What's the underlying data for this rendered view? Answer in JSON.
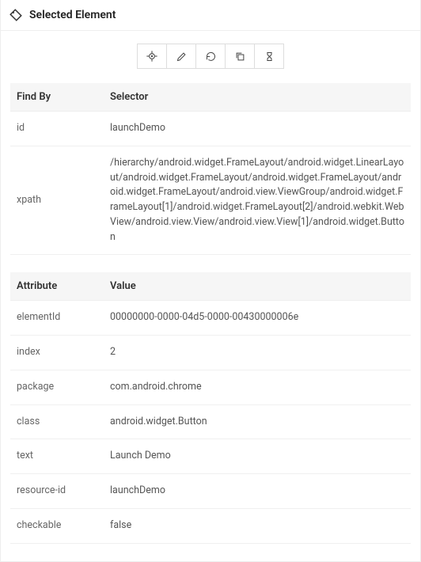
{
  "header": {
    "title": "Selected Element"
  },
  "toolbar": {
    "locate_title": "Locate",
    "edit_title": "Edit",
    "refresh_title": "Refresh",
    "copy_title": "Copy",
    "timing_title": "Timing"
  },
  "findby_table": {
    "headers": {
      "col1": "Find By",
      "col2": "Selector"
    },
    "rows": [
      {
        "k": "id",
        "v": "launchDemo"
      },
      {
        "k": "xpath",
        "v": "/hierarchy/android.widget.FrameLayout/android.widget.LinearLayout/android.widget.FrameLayout/android.widget.FrameLayout/android.widget.FrameLayout/android.view.ViewGroup/android.widget.FrameLayout[1]/android.widget.FrameLayout[2]/android.webkit.WebView/android.view.View/android.view.View[1]/android.widget.Button"
      }
    ]
  },
  "attr_table": {
    "headers": {
      "col1": "Attribute",
      "col2": "Value"
    },
    "rows": [
      {
        "k": "elementId",
        "v": "00000000-0000-04d5-0000-00430000006e"
      },
      {
        "k": "index",
        "v": "2"
      },
      {
        "k": "package",
        "v": "com.android.chrome"
      },
      {
        "k": "class",
        "v": "android.widget.Button"
      },
      {
        "k": "text",
        "v": "Launch Demo"
      },
      {
        "k": "resource-id",
        "v": "launchDemo"
      },
      {
        "k": "checkable",
        "v": "false"
      }
    ]
  }
}
